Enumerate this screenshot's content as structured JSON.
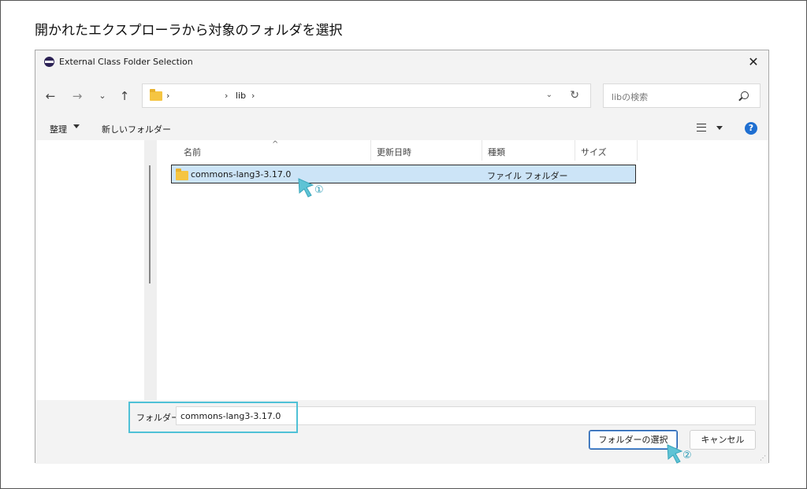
{
  "page": {
    "title": "開かれたエクスプローラから対象のフォルダを選択"
  },
  "dialog": {
    "title": "External Class Folder Selection",
    "close_label": "✕",
    "nav": {
      "back": "←",
      "forward": "→",
      "recent": "⌄",
      "up": "↑"
    },
    "address": {
      "separator": "›",
      "crumb": "lib",
      "dropdown": "⌄",
      "refresh": "↻"
    },
    "search": {
      "placeholder": "libの検索"
    },
    "commands": {
      "organize": "整理",
      "new_folder": "新しいフォルダー"
    },
    "columns": [
      "名前",
      "更新日時",
      "種類",
      "サイズ"
    ],
    "sort_indicator": "^",
    "files": [
      {
        "name": "commons-lang3-3.17.0",
        "modified": "",
        "type": "ファイル フォルダー",
        "size": ""
      }
    ],
    "folder_field": {
      "label": "フォルダー:",
      "value": "commons-lang3-3.17.0"
    },
    "buttons": {
      "select": "フォルダーの選択",
      "cancel": "キャンセル"
    }
  },
  "annotations": {
    "step1": "①",
    "step2": "②"
  },
  "colors": {
    "accent": "#4fc1d6",
    "selection": "#cce4f7",
    "folder": "#f5c542",
    "help": "#1f6fd1"
  }
}
